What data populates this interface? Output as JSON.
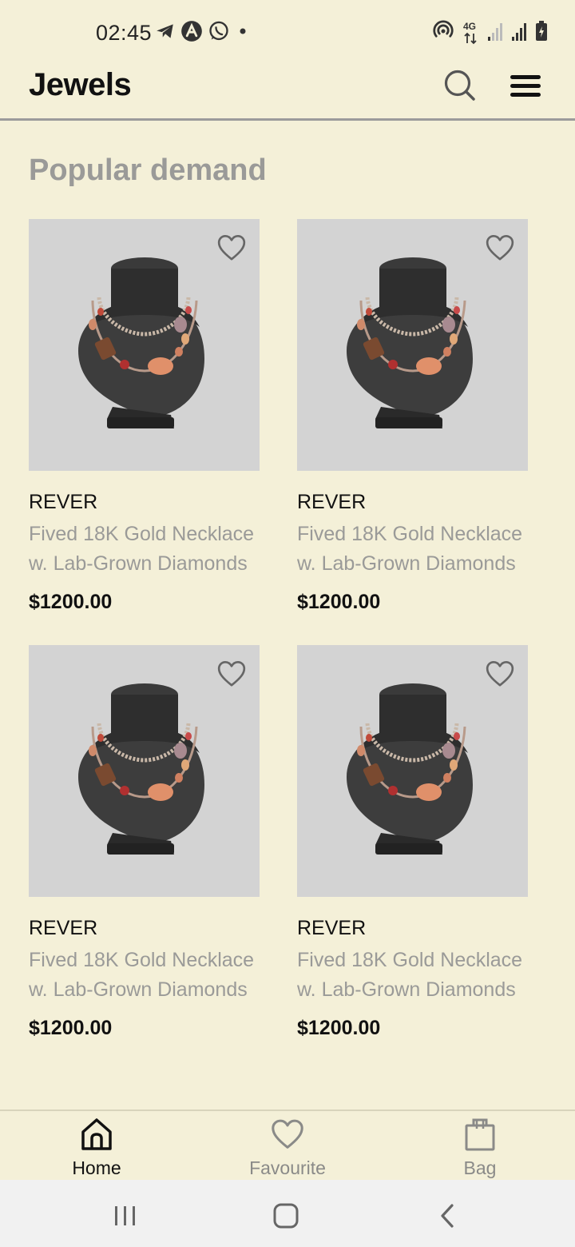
{
  "status_bar": {
    "time": "02:45",
    "left_icons": [
      "telegram-icon",
      "a-app-icon",
      "whatsapp-icon",
      "notification-dot-icon"
    ],
    "right_icons": [
      "hotspot-icon",
      "4g-data-icon",
      "signal-bars-icon",
      "signal-bars-icon",
      "battery-charging-icon"
    ],
    "network_label": "4G"
  },
  "app_bar": {
    "title": "Jewels",
    "icons": [
      "search-icon",
      "menu-icon"
    ]
  },
  "main": {
    "section_title": "Popular demand",
    "products": [
      {
        "brand": "REVER",
        "name": "Fived 18K Gold Necklace w. Lab-Grown Diamonds",
        "price": "$1200.00",
        "favourite": false
      },
      {
        "brand": "REVER",
        "name": "Fived 18K Gold Necklace w. Lab-Grown Diamonds",
        "price": "$1200.00",
        "favourite": false
      },
      {
        "brand": "REVER",
        "name": "Fived 18K Gold Necklace w. Lab-Grown Diamonds",
        "price": "$1200.00",
        "favourite": false
      },
      {
        "brand": "REVER",
        "name": "Fived 18K Gold Necklace w. Lab-Grown Diamonds",
        "price": "$1200.00",
        "favourite": false
      }
    ]
  },
  "bottom_nav": {
    "items": [
      {
        "label": "Home",
        "icon": "home-icon",
        "active": true
      },
      {
        "label": "Favourite",
        "icon": "heart-icon",
        "active": false
      },
      {
        "label": "Bag",
        "icon": "shopping-bag-icon",
        "active": false
      }
    ]
  },
  "system_nav": {
    "buttons": [
      "recent-apps-icon",
      "home-circle-icon",
      "back-icon"
    ]
  },
  "colors": {
    "background": "#f4f0d8",
    "image_placeholder": "#d3d3d3",
    "muted_text": "#9a9a98",
    "primary_text": "#111111",
    "active_nav": "#111111",
    "inactive_nav": "#8a8a88"
  }
}
